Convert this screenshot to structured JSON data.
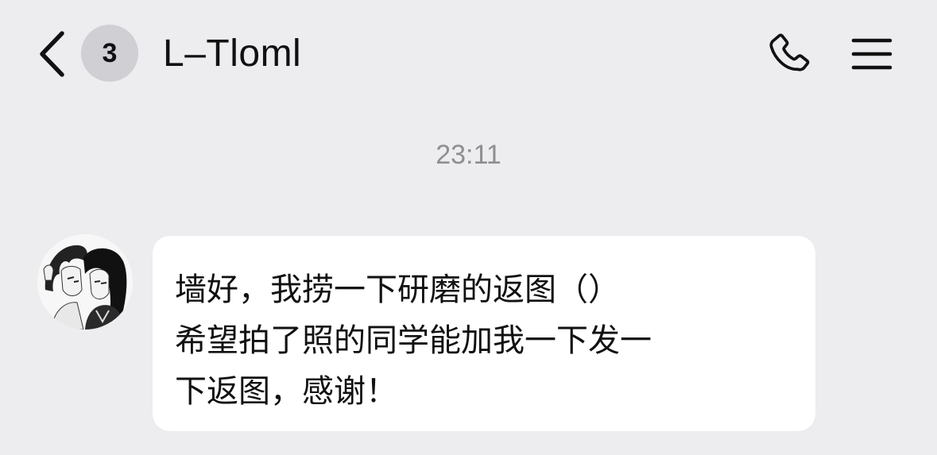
{
  "header": {
    "back_icon": "chevron-left-icon",
    "unread_count": "3",
    "title": "L–Tloml",
    "call_icon": "phone-icon",
    "menu_icon": "menu-icon"
  },
  "conversation": {
    "timestamp": "23:11",
    "messages": [
      {
        "sender_avatar": "anime-couple-avatar",
        "text": "墙好，我捞一下研磨的返图（）\n希望拍了照的同学能加我一下发一\n下返图，感谢！"
      }
    ]
  },
  "colors": {
    "background": "#ededf0",
    "bubble": "#ffffff",
    "badge": "#cfcfd4",
    "timestamp": "#8e8e93",
    "text": "#111111"
  }
}
